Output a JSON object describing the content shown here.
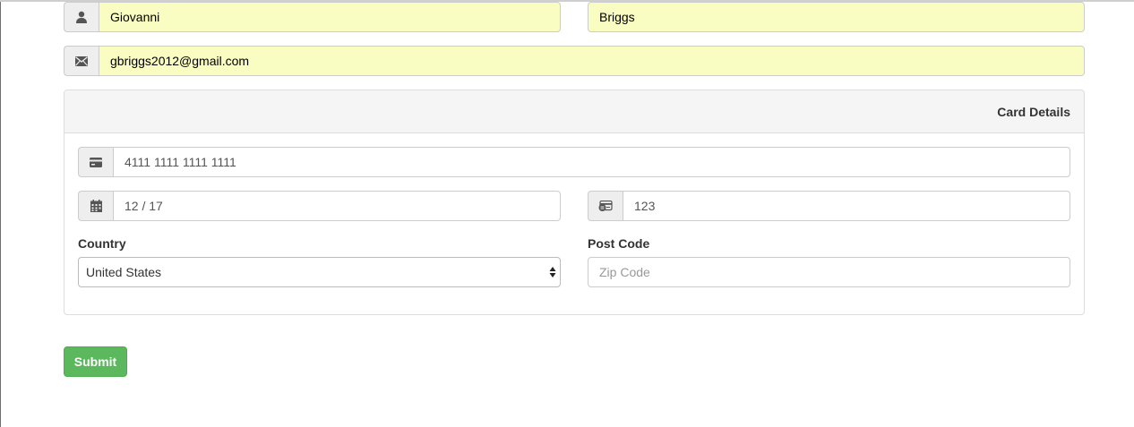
{
  "name": {
    "first_value": "Giovanni",
    "last_value": "Briggs"
  },
  "email": {
    "value": "gbriggs2012@gmail.com"
  },
  "card": {
    "heading": "Card Details",
    "number_value": "4111 1111 1111 1111",
    "expiry_value": "12 / 17",
    "cvc_value": "123"
  },
  "address": {
    "country_label": "Country",
    "country_value": "United States",
    "postcode_label": "Post Code",
    "postcode_placeholder": "Zip Code"
  },
  "actions": {
    "submit_label": "Submit"
  },
  "colors": {
    "autofill_bg": "#fafdc1",
    "submit_bg": "#5cb85c"
  },
  "icons": [
    "user-icon",
    "envelope-icon",
    "credit-card-icon",
    "calendar-icon",
    "cvc-card-icon",
    "select-arrows-icon"
  ]
}
